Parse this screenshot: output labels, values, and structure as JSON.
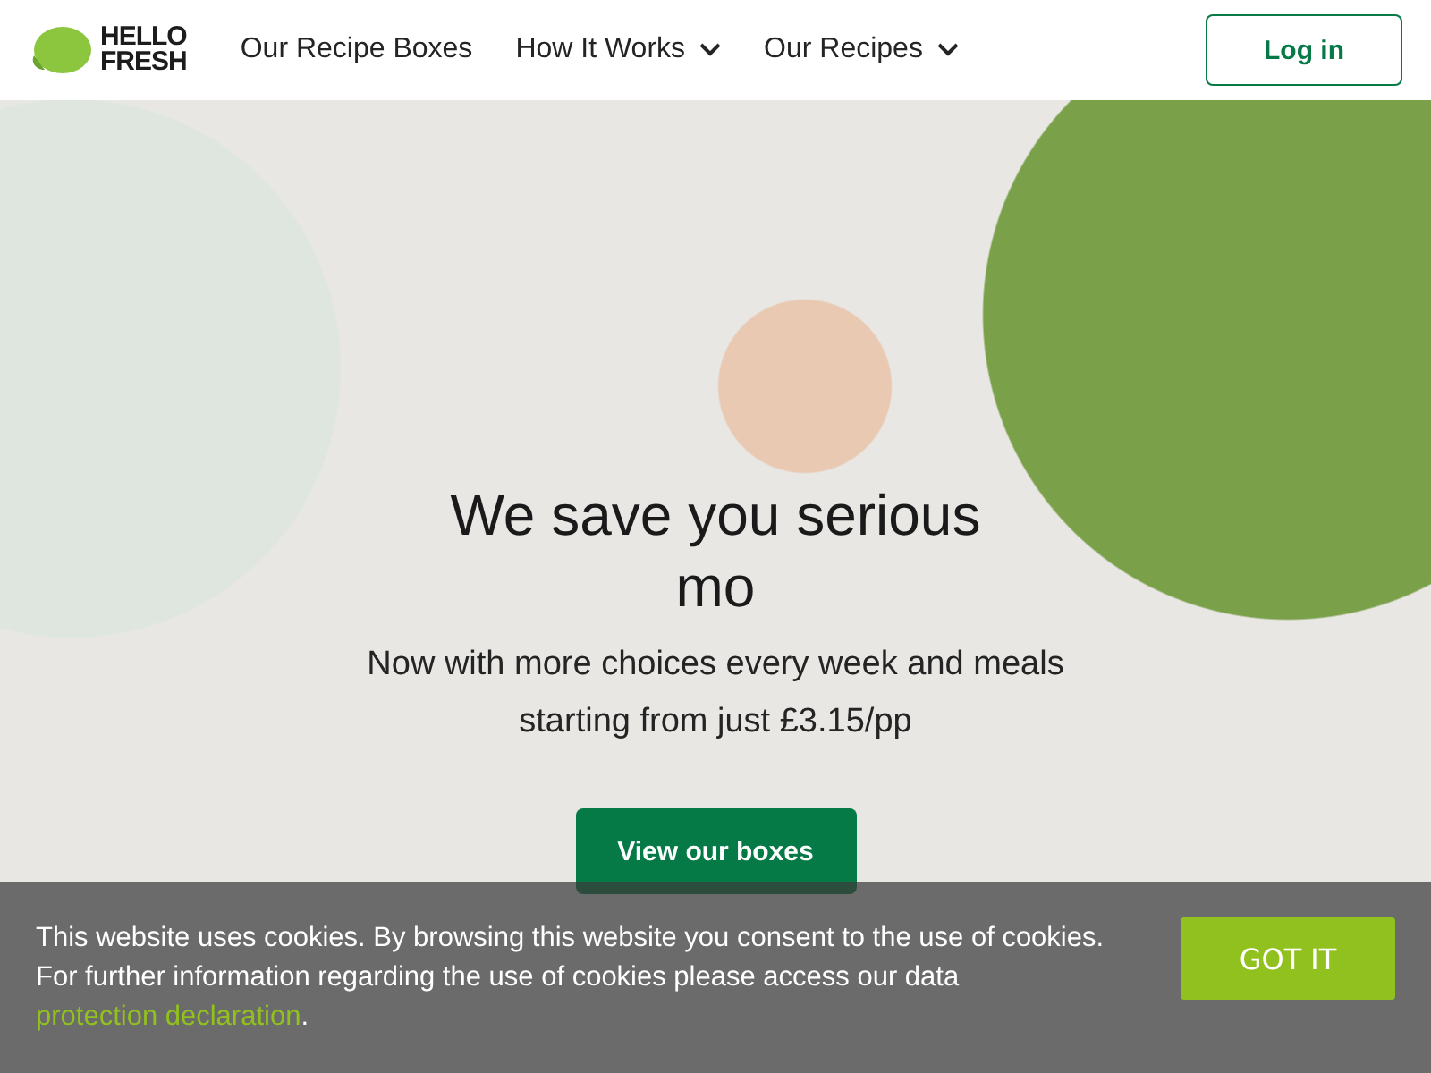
{
  "header": {
    "logo": {
      "line1": "HELLO",
      "line2": "FRESH"
    },
    "nav": [
      {
        "label": "Our Recipe Boxes",
        "has_menu": false
      },
      {
        "label": "How It Works",
        "has_menu": true
      },
      {
        "label": "Our Recipes",
        "has_menu": true
      }
    ],
    "login": "Log in"
  },
  "hero": {
    "heading": "We save you serious mo",
    "subtitle": "Now with more choices every week and meals starting from just £3.15/pp",
    "button": "View our boxes"
  },
  "cookie_banner": {
    "text": "This website uses cookies. By browsing this website you consent to the use of cookies. For further information regarding the use of cookies please access our data ",
    "link": "protection declaration",
    "after": ".",
    "button": "GOT IT"
  }
}
